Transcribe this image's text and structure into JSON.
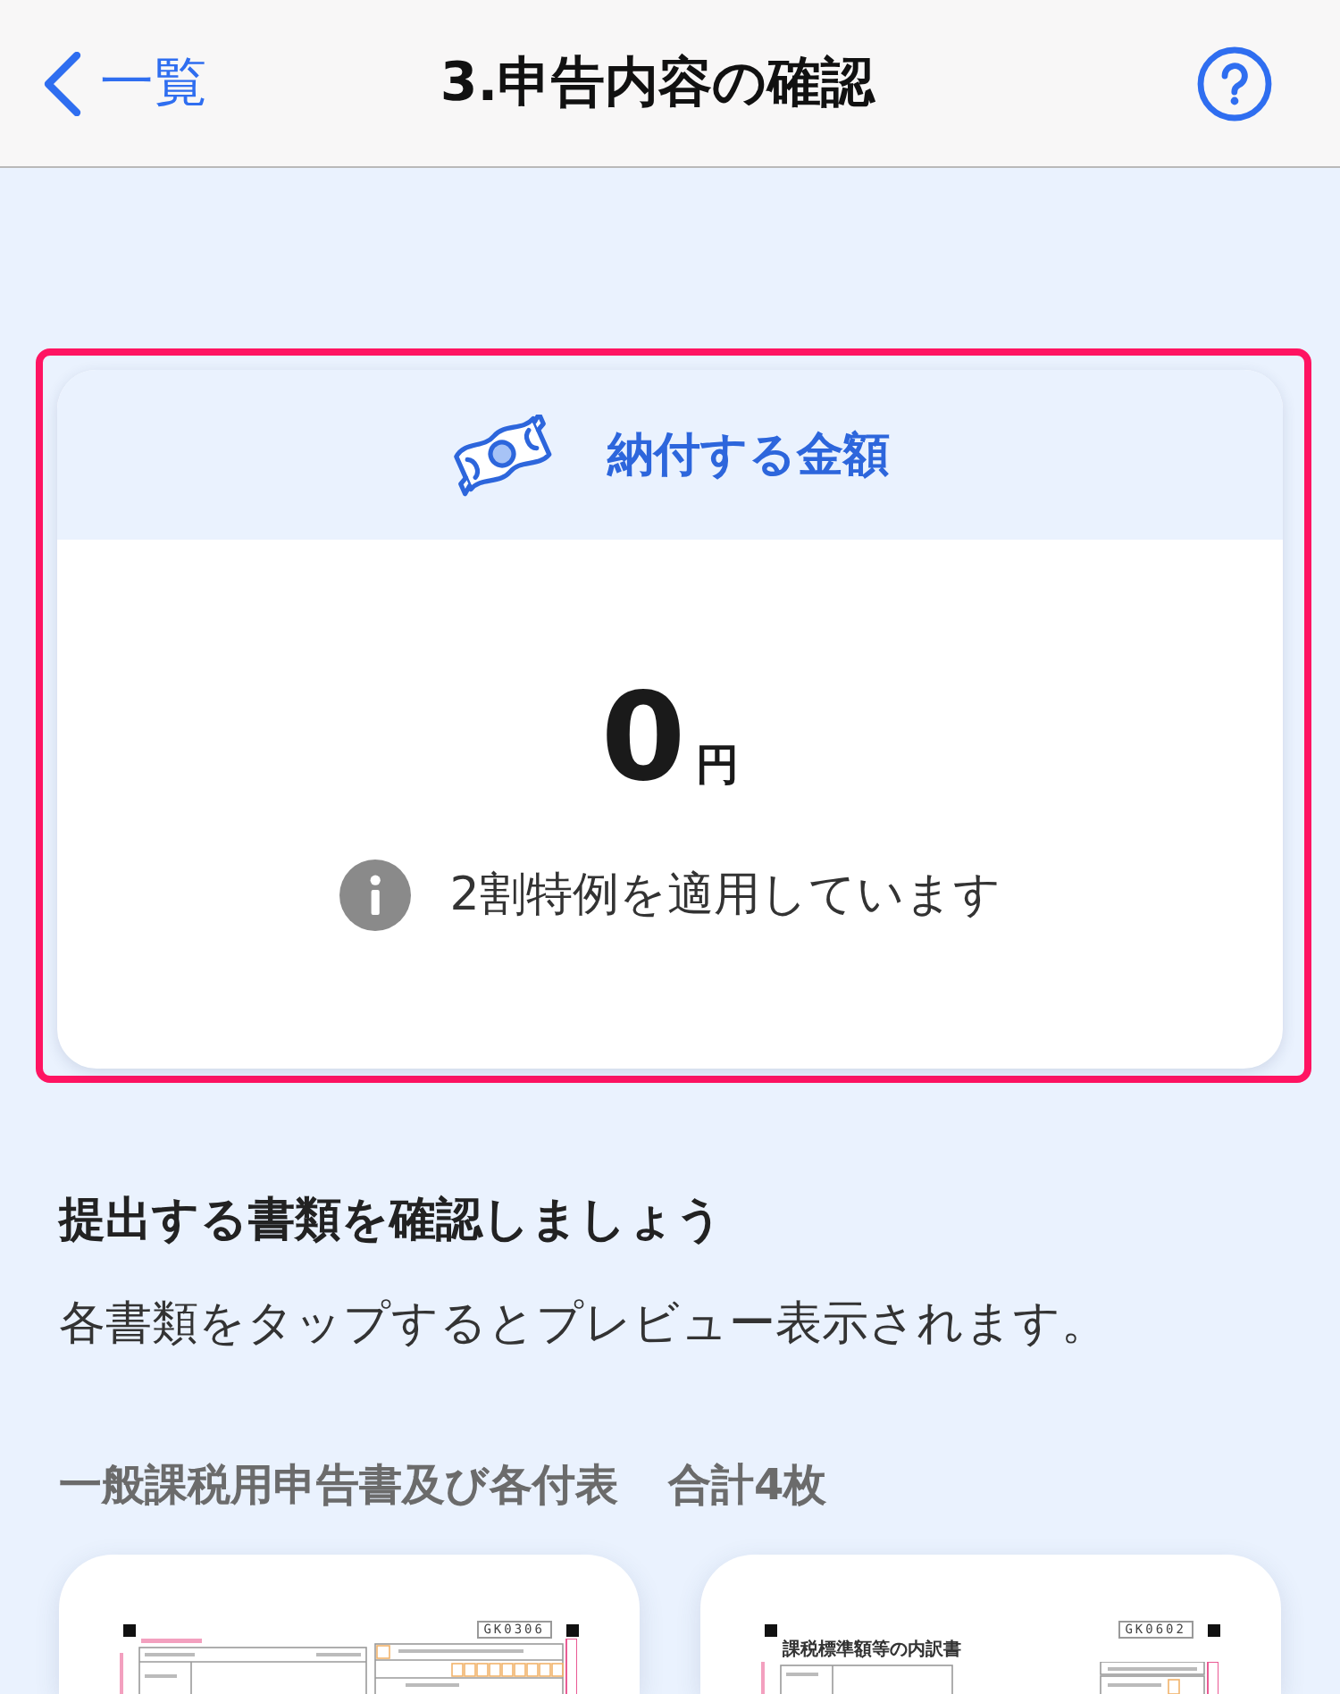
{
  "nav_bar": {
    "back_label": "一覧",
    "title": "3.申告内容の確認"
  },
  "payment_card": {
    "highlighted": true,
    "heading": "納付する金額",
    "amount": "0",
    "unit": "円",
    "note": "2割特例を適用しています"
  },
  "documents_section": {
    "heading": "提出する書類を確認しましょう",
    "description": "各書類をタップするとプレビュー表示されます。",
    "group_title": "一般課税用申告書及び各付表",
    "group_count": "合計4枚",
    "documents": [
      {
        "kind": "return",
        "form_code": "GK0306"
      },
      {
        "kind": "breakdown",
        "form_code": "GK0602",
        "form_title": "課税標準額等の内訳書"
      }
    ]
  }
}
